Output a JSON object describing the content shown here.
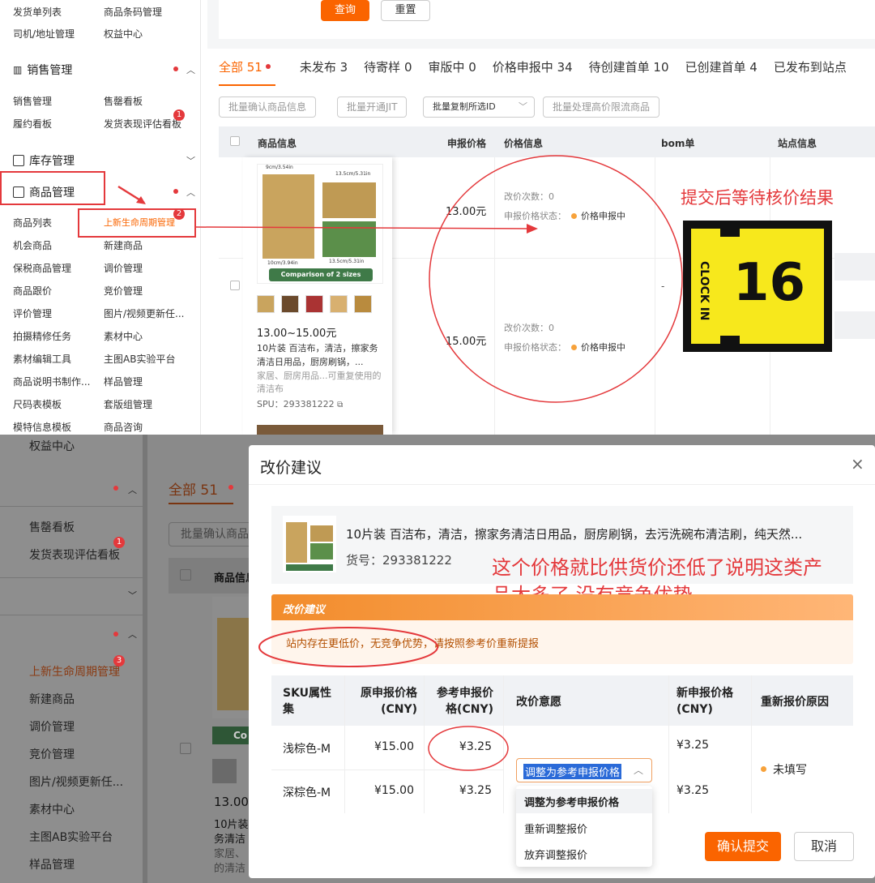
{
  "sidebar": {
    "top_links": [
      "发货单列表",
      "商品条码管理",
      "司机/地址管理",
      "权益中心"
    ],
    "sales": {
      "title": "销售管理",
      "links": [
        "销售管理",
        "售罄看板",
        "履约看板",
        "发货表现评估看板"
      ]
    },
    "inventory": {
      "title": "库存管理"
    },
    "product": {
      "title": "商品管理",
      "links": [
        "商品列表",
        "上新生命周期管理",
        "机会商品",
        "新建商品",
        "保税商品管理",
        "调价管理",
        "商品跟价",
        "竞价管理",
        "评价管理",
        "图片/视频更新任...",
        "拍摄精修任务",
        "素材中心",
        "素材编辑工具",
        "主图AB实验平台",
        "商品说明书制作...",
        "样品管理",
        "尺码表模板",
        "套版组管理",
        "模特信息模板",
        "商品咨询"
      ]
    },
    "badges": [
      "1",
      "2",
      "3"
    ]
  },
  "toolbar": {
    "query": "查询",
    "reset": "重置"
  },
  "tabs": [
    "全部 51",
    "未发布 3",
    "待寄样 0",
    "审版中 0",
    "价格申报中 34",
    "待创建首单 10",
    "已创建首单 4",
    "已发布到站点"
  ],
  "batch": [
    "批量确认商品信息",
    "批量开通JIT",
    "批量复制所选ID",
    "批量处理高价限流商品"
  ],
  "table": {
    "headers": [
      "商品信息",
      "申报价格",
      "价格信息",
      "bom单",
      "站点信息"
    ],
    "product": {
      "img_label": "Comparison of 2 sizes",
      "dims": [
        "9cm/3.54in",
        "13.5cm/5.31in",
        "10cm/3.94in",
        "13.5cm/5.31in"
      ],
      "price_range": "13.00~15.00元",
      "title": "10片装 百洁布，清洁，擦家务清洁日用品，厨房刷锅，...",
      "category": "家居、厨房用品...可重复使用的清洁布",
      "spu": "SPU：293381222"
    },
    "rows": [
      {
        "price": "13.00元",
        "changes": "改价次数：0",
        "status_label": "申报价格状态：",
        "status": "价格申报中"
      },
      {
        "price": "15.00元",
        "changes": "改价次数：0",
        "status_label": "申报价格状态：",
        "status": "价格申报中"
      }
    ],
    "bom_dash": "-"
  },
  "annotations": {
    "submit": "提交后等待核价结果",
    "clock_word": "CLOCK IN",
    "clock_num": "16",
    "low_price": "这个价格就比供货价还低了说明这类产品太多了 没有竞争优势"
  },
  "background2": {
    "tab": "全部 51",
    "batch": "批量确认商品",
    "header": "商品信息",
    "links": [
      "权益中心",
      "售罄看板",
      "发货表现评估看板",
      "上新生命周期管理",
      "新建商品",
      "调价管理",
      "竞价管理",
      "图片/视频更新任...",
      "素材中心",
      "主图AB实验平台",
      "样品管理"
    ],
    "price": "13.00",
    "prod_lines": [
      "10片装",
      "务清洁",
      "家居、",
      "的清洁"
    ],
    "co": "Co"
  },
  "modal": {
    "title": "改价建议",
    "close": "×",
    "product_title": "10片装 百洁布，清洁，擦家务清洁日用品，厨房刷锅，去污洗碗布清洁刷，纯天然...",
    "item_no": "货号：293381222",
    "advice_title": "改价建议",
    "advice_text": "站内存在更低价，无竞争优势，请按照参考价重新提报",
    "headers": [
      "SKU属性集",
      "原申报价格(CNY)",
      "参考申报价格(CNY)",
      "改价意愿",
      "新申报价格(CNY)",
      "重新报价原因"
    ],
    "rows": [
      {
        "sku": "浅棕色-M",
        "orig": "¥15.00",
        "ref": "¥3.25",
        "new": "¥3.25"
      },
      {
        "sku": "深棕色-M",
        "orig": "¥15.00",
        "ref": "¥3.25",
        "new": "¥3.25"
      }
    ],
    "select_value": "调整为参考申报价格",
    "options": [
      "调整为参考申报价格",
      "重新调整报价",
      "放弃调整报价"
    ],
    "reason": "未填写",
    "confirm": "确认提交",
    "cancel": "取消"
  }
}
